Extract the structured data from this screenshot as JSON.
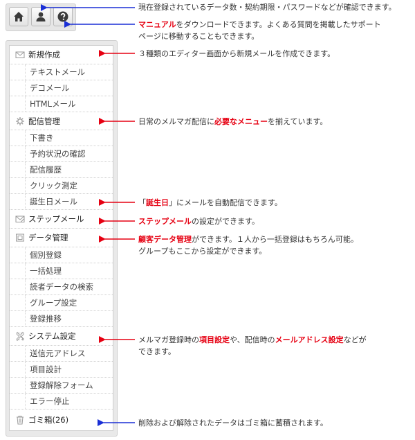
{
  "toolbar": {
    "buttons": [
      {
        "icon": "home-icon"
      },
      {
        "icon": "user-icon"
      },
      {
        "icon": "help-icon"
      }
    ]
  },
  "menu": {
    "new_mail": {
      "label": "新規作成",
      "icon": "envelope-icon",
      "items": [
        "テキストメール",
        "デコメール",
        "HTMLメール"
      ]
    },
    "delivery": {
      "label": "配信管理",
      "icon": "gear-icon",
      "items": [
        "下書き",
        "予約状況の確認",
        "配信履歴",
        "クリック測定",
        "誕生日メール"
      ]
    },
    "step_mail": {
      "label": "ステップメール",
      "icon": "step-envelope-icon"
    },
    "data_mgmt": {
      "label": "データ管理",
      "icon": "data-box-icon",
      "items": [
        "個別登録",
        "一括処理",
        "読者データの検索",
        "グループ設定",
        "登録推移"
      ]
    },
    "system": {
      "label": "システム設定",
      "icon": "wrench-icon",
      "items": [
        "送信元アドレス",
        "項目設計",
        "登録解除フォーム",
        "エラー停止"
      ]
    },
    "trash": {
      "label": "ゴミ箱(26)",
      "icon": "trash-icon"
    }
  },
  "annotations": {
    "account": {
      "text": "現在登録されているデータ数・契約期限・パスワードなどが確認できます。"
    },
    "manual": {
      "hl": "マニュアル",
      "line1": "をダウンロードできます。よくある質問を掲載したサポート",
      "line2": "ページに移動することもできます。"
    },
    "new_mail": {
      "text": "３種類のエディター画面から新規メールを作成できます。"
    },
    "delivery": {
      "pre": "日常のメルマガ配信に",
      "hl": "必要なメニュー",
      "post": "を揃えています。"
    },
    "birthday": {
      "pre": "「",
      "hl": "誕生日",
      "post": "」にメールを自動配信できます。"
    },
    "step": {
      "hl": "ステップメール",
      "post": "の設定ができます。"
    },
    "data": {
      "hl": "顧客データ管理",
      "line1": "ができます。１人から一括登録はもちろん可能。",
      "line2": "グループもここから設定ができます。"
    },
    "system": {
      "pre": "メルマガ登録時の",
      "hl1": "項目設定",
      "mid": "や、配信時の",
      "hl2": "メールアドレス設定",
      "post": "などが",
      "line2": "できます。"
    },
    "trash": {
      "text": "削除および解除されたデータはゴミ箱に蓄積されます。"
    }
  },
  "colors": {
    "arrow_blue": "#1a2fd6",
    "arrow_red": "#e60012",
    "highlight_red": "#e60012"
  }
}
